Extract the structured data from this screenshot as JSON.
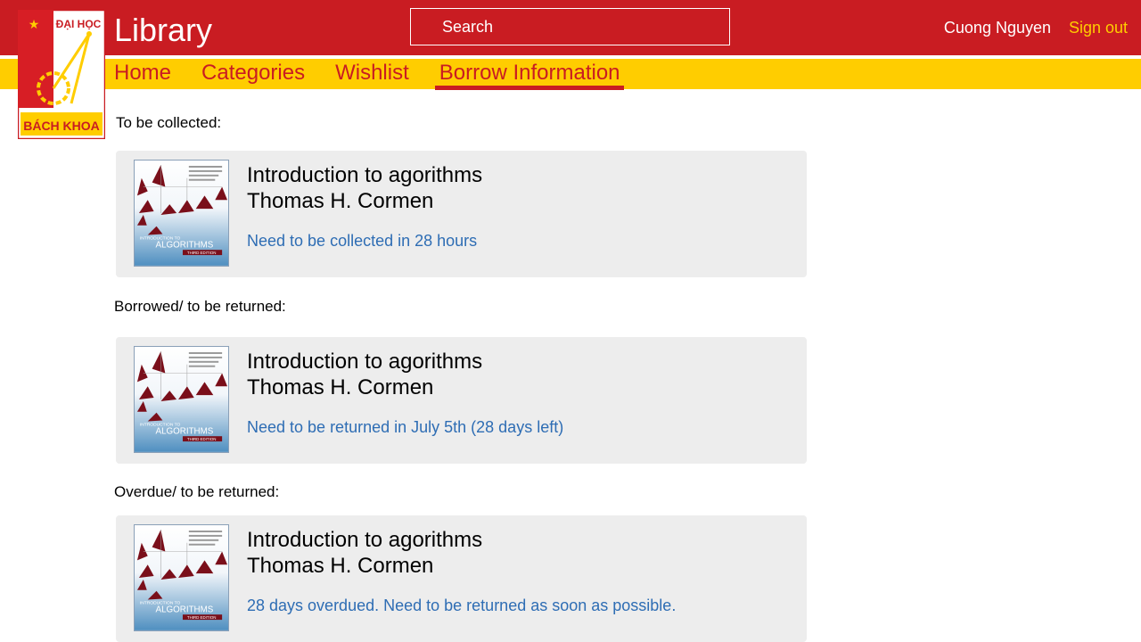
{
  "header": {
    "app_title": "Library",
    "search_placeholder": "Search",
    "user_name": "Cuong Nguyen",
    "sign_out_label": "Sign out",
    "logo": {
      "top_text": "ĐẠI HỌC",
      "bottom_text": "BÁCH KHOA"
    }
  },
  "nav": {
    "items": [
      {
        "label": "Home"
      },
      {
        "label": "Categories"
      },
      {
        "label": "Wishlist"
      },
      {
        "label": "Borrow Information",
        "active": true
      }
    ]
  },
  "sections": [
    {
      "label": "To be collected:",
      "book": {
        "title": "Introduction to agorithms",
        "author": "Thomas H. Cormen",
        "status": "Need to be collected in 28 hours"
      }
    },
    {
      "label": "Borrowed/ to be returned:",
      "book": {
        "title": "Introduction to agorithms",
        "author": "Thomas H. Cormen",
        "status": "Need to be returned in July 5th (28 days left)"
      }
    },
    {
      "label": "Overdue/ to be returned:",
      "book": {
        "title": "Introduction to agorithms",
        "author": "Thomas H. Cormen",
        "status": "28 days overdued. Need to be returned as soon as possible."
      }
    }
  ],
  "cover": {
    "line1": "INTRODUCTION TO",
    "line2": "ALGORITHMS",
    "edition": "THIRD EDITION"
  },
  "colors": {
    "header_red": "#c91c22",
    "nav_yellow": "#ffcd00",
    "status_blue": "#2e6db4",
    "card_gray": "#ededed"
  }
}
